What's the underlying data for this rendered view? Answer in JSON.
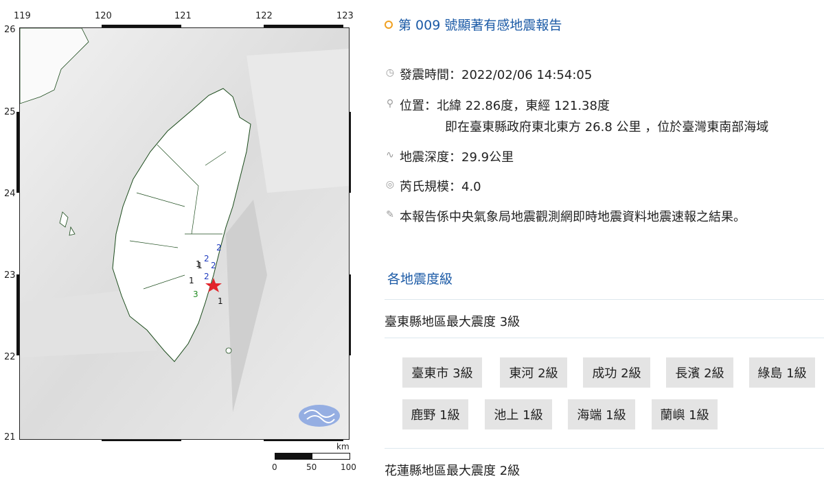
{
  "map": {
    "lon_labels": [
      "119",
      "120",
      "121",
      "122",
      "123"
    ],
    "lat_labels": [
      "26",
      "25",
      "24",
      "23",
      "22",
      "21"
    ],
    "scale_unit": "km",
    "scale_labels": [
      "0",
      "50",
      "100"
    ],
    "station_labels": [
      "2",
      "2",
      "1",
      "2",
      "1",
      "2",
      "1",
      "3",
      "1"
    ],
    "epicenter_color": "#e3242b",
    "coast_color": "#1a4a1a"
  },
  "report": {
    "title": "第 009 號顯著有感地震報告",
    "time": "發震時間：2022/02/06 14:54:05",
    "location": "位置：北緯 22.86度，東經 121.38度",
    "location_detail": "即在臺東縣政府東北東方 26.8 公里 ，位於臺灣東南部海域",
    "depth": "地震深度：29.9公里",
    "magnitude": "芮氏規模：4.0",
    "note": "本報告係中央氣象局地震觀測網即時地震資料地震速報之結果。"
  },
  "intensity": {
    "section_title": "各地震度級",
    "county1": "臺東縣地區最大震度 3級",
    "stations": [
      "臺東市 3級",
      "東河 2級",
      "成功 2級",
      "長濱 2級",
      "綠島 1級",
      "鹿野 1級",
      "池上 1級",
      "海端 1級",
      "蘭嶼 1級"
    ],
    "county2": "花蓮縣地區最大震度 2級"
  }
}
